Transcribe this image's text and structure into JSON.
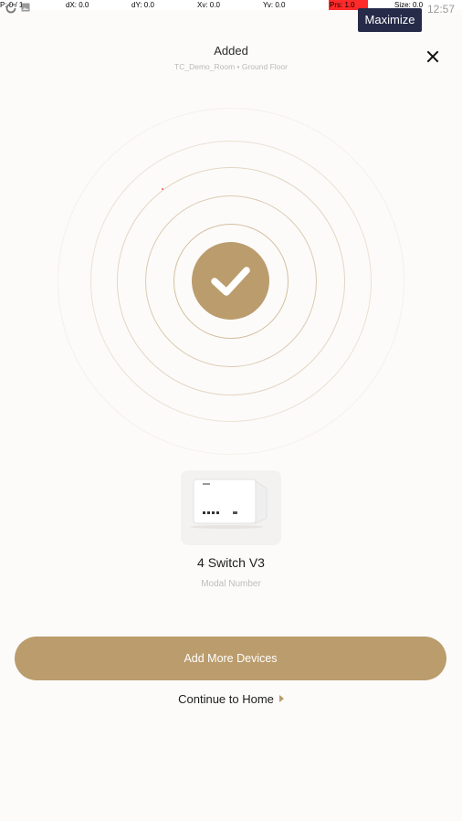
{
  "dev_overlay": {
    "p": "P: 0 / 1",
    "dx": "dX: 0.0",
    "dy": "dY: 0.0",
    "xv": "Xv: 0.0",
    "yv": "Yv: 0.0",
    "prs": "Prs: 1.0",
    "size": "Size: 0.0"
  },
  "status_bar": {
    "time": "12:57",
    "icons": [
      "sync-icon",
      "image-icon"
    ]
  },
  "tooltip": "Maximize",
  "header": {
    "title": "Added",
    "subtitle": "TC_Demo_Room • Ground Floor",
    "close_icon": "close-icon"
  },
  "success": {
    "icon": "checkmark-icon",
    "accent_color": "#bb9c6c"
  },
  "device": {
    "name": "4 Switch V3",
    "model": "Modal Number",
    "image": "switch-module-image"
  },
  "actions": {
    "primary_label": "Add More Devices",
    "secondary_label": "Continue to Home"
  },
  "colors": {
    "background": "#fcfbfa",
    "accent": "#bb9c6c",
    "tooltip_bg": "#262b4a",
    "overlay_red": "#ff2a2a"
  }
}
